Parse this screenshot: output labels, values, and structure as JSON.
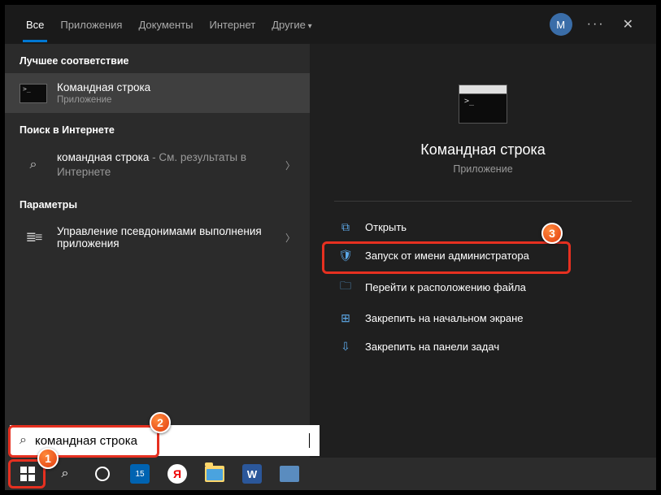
{
  "tabs": {
    "all": "Все",
    "apps": "Приложения",
    "docs": "Документы",
    "internet": "Интернет",
    "other": "Другие"
  },
  "avatar": "M",
  "left": {
    "best_match": "Лучшее соответствие",
    "result": {
      "title": "Командная строка",
      "sub": "Приложение"
    },
    "web_header": "Поиск в Интернете",
    "web_item": {
      "query": "командная строка",
      "aux": " - См. результаты в Интернете"
    },
    "params_header": "Параметры",
    "params_item": "Управление псевдонимами выполнения приложения"
  },
  "preview": {
    "title": "Командная строка",
    "sub": "Приложение"
  },
  "actions": {
    "open": "Открыть",
    "admin": "Запуск от имени администратора",
    "location": "Перейти к расположению файла",
    "pin_start": "Закрепить на начальном экране",
    "pin_taskbar": "Закрепить на панели задач"
  },
  "search": {
    "value": "командная строка"
  },
  "badges": {
    "b1": "1",
    "b2": "2",
    "b3": "3"
  }
}
